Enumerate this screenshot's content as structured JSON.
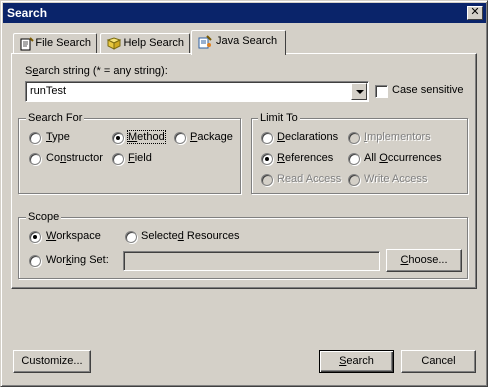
{
  "window": {
    "title": "Search",
    "close_glyph": "✕"
  },
  "tabs": [
    {
      "label": "File Search",
      "icon": "file-search-icon"
    },
    {
      "label": "Help Search",
      "icon": "help-search-icon"
    },
    {
      "label": "Java Search",
      "icon": "java-search-icon",
      "active": true
    }
  ],
  "search_string": {
    "label_prefix": "S",
    "label_u": "e",
    "label_rest": "arch string (* = any string):",
    "value": "runTest",
    "case_sensitive": {
      "label": "Case sensitive",
      "checked": false
    }
  },
  "search_for": {
    "title": "Search For",
    "options": {
      "type": {
        "u": "T",
        "rest": "ype",
        "checked": false
      },
      "method": {
        "u": "M",
        "rest": "ethod",
        "checked": true
      },
      "package": {
        "u": "P",
        "rest": "ackage",
        "checked": false
      },
      "constructor": {
        "pre": "Co",
        "u": "n",
        "rest": "structor",
        "checked": false
      },
      "field": {
        "u": "F",
        "rest": "ield",
        "checked": false
      }
    }
  },
  "limit_to": {
    "title": "Limit To",
    "options": {
      "declarations": {
        "u": "D",
        "rest": "eclarations",
        "checked": false,
        "enabled": true
      },
      "implementors": {
        "u": "I",
        "rest": "mplementors",
        "checked": false,
        "enabled": false
      },
      "references": {
        "u": "R",
        "rest": "eferences",
        "checked": true,
        "enabled": true
      },
      "all_occurrences": {
        "pre": "All ",
        "u": "O",
        "rest": "ccurrences",
        "checked": false,
        "enabled": true
      },
      "read_access": {
        "label": "Read Access",
        "checked": false,
        "enabled": false
      },
      "write_access": {
        "label": "Write Access",
        "checked": false,
        "enabled": false
      }
    }
  },
  "scope": {
    "title": "Scope",
    "workspace": {
      "u": "W",
      "rest": "orkspace",
      "checked": true
    },
    "selected_resources": {
      "pre": "Selecte",
      "u": "d",
      "rest": " Resources",
      "checked": false
    },
    "working_set": {
      "pre": "Wor",
      "u": "k",
      "rest": "ing Set:",
      "checked": false,
      "value": ""
    },
    "choose_button": {
      "u": "C",
      "rest": "hoose..."
    }
  },
  "footer": {
    "customize": "Customize...",
    "search": {
      "u": "S",
      "rest": "earch"
    },
    "cancel": "Cancel"
  }
}
